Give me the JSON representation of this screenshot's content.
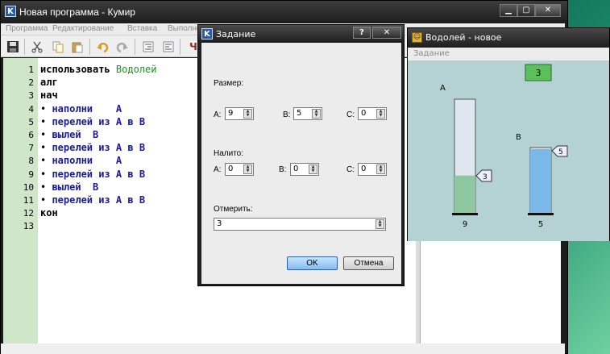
{
  "main_window": {
    "title": "Новая программа - Кумир",
    "icon_letter": "K",
    "menu": [
      "Программа",
      "Редактирование",
      "Вставка",
      "Выполне"
    ]
  },
  "editor": {
    "lines": [
      {
        "n": "1",
        "parts": [
          [
            "kw",
            "использовать "
          ],
          [
            "green",
            "Водолей"
          ]
        ]
      },
      {
        "n": "2",
        "parts": [
          [
            "kw",
            "алг"
          ]
        ]
      },
      {
        "n": "3",
        "parts": [
          [
            "kw",
            "нач"
          ]
        ]
      },
      {
        "n": "4",
        "parts": [
          [
            "bul",
            "• "
          ],
          [
            "act",
            "наполни    А"
          ]
        ]
      },
      {
        "n": "5",
        "parts": [
          [
            "bul",
            "• "
          ],
          [
            "act",
            "перелей из А в В"
          ]
        ]
      },
      {
        "n": "6",
        "parts": [
          [
            "bul",
            "• "
          ],
          [
            "act",
            "вылей  В"
          ]
        ]
      },
      {
        "n": "7",
        "parts": [
          [
            "bul",
            "• "
          ],
          [
            "act",
            "перелей из А в В"
          ]
        ]
      },
      {
        "n": "8",
        "parts": [
          [
            "bul",
            "• "
          ],
          [
            "act",
            "наполни    А"
          ]
        ]
      },
      {
        "n": "9",
        "parts": [
          [
            "bul",
            "• "
          ],
          [
            "act",
            "перелей из А в В"
          ]
        ]
      },
      {
        "n": "10",
        "parts": [
          [
            "bul",
            "• "
          ],
          [
            "act",
            "вылей  В"
          ]
        ]
      },
      {
        "n": "11",
        "parts": [
          [
            "bul",
            "• "
          ],
          [
            "act",
            "перелей из А в В"
          ]
        ]
      },
      {
        "n": "12",
        "parts": [
          [
            "kw",
            "кон"
          ]
        ]
      },
      {
        "n": "13",
        "parts": []
      }
    ]
  },
  "vodolei": {
    "title": "Водолей - новое",
    "menu_label": "Задание",
    "goal": "3",
    "vessel_a": {
      "name": "A",
      "capacity": "9",
      "level": "3",
      "fill_fraction": 0.333
    },
    "vessel_b": {
      "name": "B",
      "capacity": "5",
      "level": "5",
      "fill_fraction": 1.0
    }
  },
  "dialog": {
    "title": "Задание",
    "help_label": "?",
    "close_label": "✕",
    "size_label": "Размер:",
    "a_label": "A:",
    "b_label": "B:",
    "c_label": "C:",
    "size_a": "9",
    "size_b": "5",
    "size_c": "0",
    "filled_label": "Налито:",
    "filled_a": "0",
    "filled_b": "0",
    "filled_c": "0",
    "measure_label": "Отмерить:",
    "measure_value": "3",
    "ok_label": "OK",
    "cancel_label": "Отмена"
  },
  "colors": {
    "gutter": "#cfe6c9",
    "vessel_water": "#9cc8e8",
    "goal_bg": "#5cc05c",
    "canvas_bg": "#b4d2d3"
  }
}
